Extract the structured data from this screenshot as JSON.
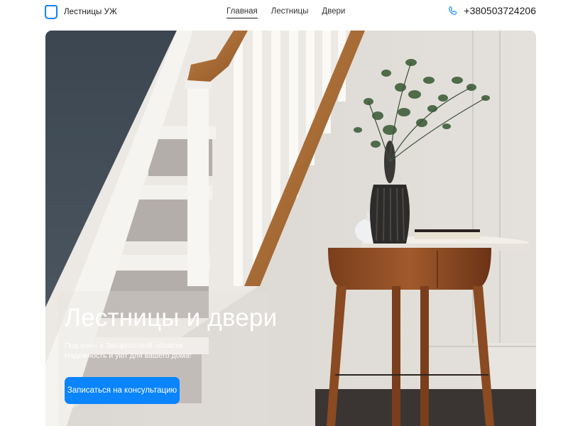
{
  "header": {
    "logo_text": "Лестницы УЖ",
    "nav": [
      {
        "label": "Главная",
        "active": true
      },
      {
        "label": "Лестницы",
        "active": false
      },
      {
        "label": "Двери",
        "active": false
      }
    ],
    "phone": "+380503724206"
  },
  "hero": {
    "title": "Лестницы и двери",
    "subtitle_line1": "Под ключ в Закарпатской области.",
    "subtitle_line2": "Надежность и уют для вашего дома!",
    "cta_label": "Записаться на консультацию"
  },
  "icons": {
    "logo": "logo-square-icon",
    "phone": "phone-icon"
  },
  "colors": {
    "accent": "#0a84ff",
    "text": "#1d1d1f"
  }
}
